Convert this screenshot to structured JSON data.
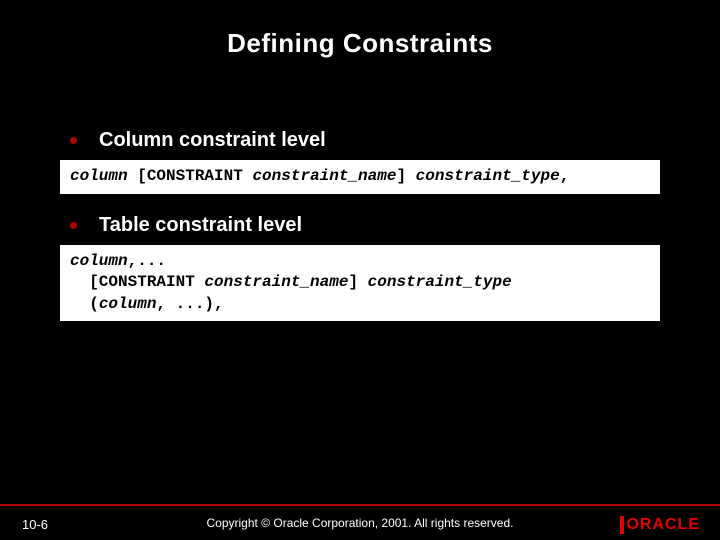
{
  "title": "Defining Constraints",
  "bullets": [
    {
      "text": "Column constraint level"
    },
    {
      "text": "Table constraint level"
    }
  ],
  "code1": {
    "p1": "column",
    "p2": " [CONSTRAINT ",
    "p3": "constraint_name",
    "p4": "] ",
    "p5": "constraint_type",
    "p6": ","
  },
  "code2": {
    "l1a": "column",
    "l1b": ",...",
    "l2a": "  [CONSTRAINT ",
    "l2b": "constraint_name",
    "l2c": "] ",
    "l2d": "constraint_type",
    "l3a": "  (",
    "l3b": "column",
    "l3c": ", ...),"
  },
  "footer": {
    "slide_number": "10-6",
    "copyright": "Copyright © Oracle Corporation, 2001. All rights reserved.",
    "logo_text": "ORACLE"
  }
}
